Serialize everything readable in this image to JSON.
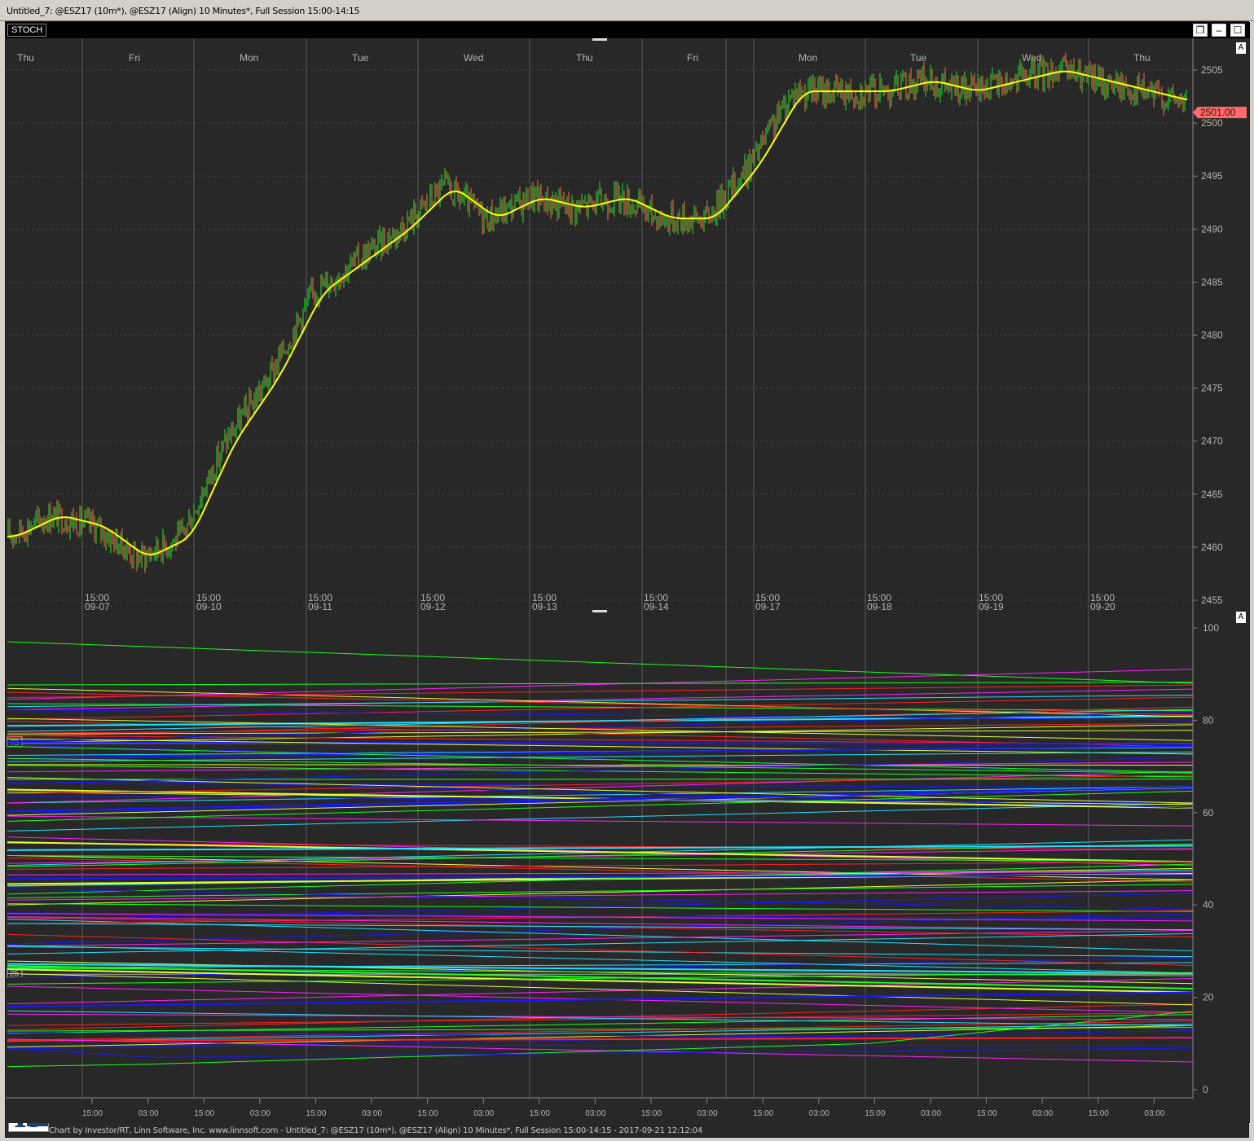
{
  "window": {
    "title": "Untitled_7: @ESZ17 (10m*), @ESZ17 (Align) 10 Minutes*, Full Session 15:00-14:15"
  },
  "toolbar": {
    "indicator_tab": "STOCH",
    "restore_icon": "restore-icon",
    "minimize_icon": "minimize-icon",
    "maximize_icon": "maximize-icon",
    "scale_badge": "A"
  },
  "price_chart": {
    "day_labels": [
      "Thu",
      "Fri",
      "Mon",
      "Tue",
      "Wed",
      "Thu",
      "Fri",
      "Mon",
      "Tue",
      "Wed",
      "Thu"
    ],
    "price_ticks": [
      "2505",
      "2500",
      "2495",
      "2490",
      "2485",
      "2480",
      "2475",
      "2470",
      "2465",
      "2460",
      "2455"
    ],
    "last_price": "2501.00",
    "time_labels": [
      {
        "time": "15:00",
        "date": "09-07"
      },
      {
        "time": "15:00",
        "date": "09-10"
      },
      {
        "time": "15:00",
        "date": "09-11"
      },
      {
        "time": "15:00",
        "date": "09-12"
      },
      {
        "time": "15:00",
        "date": "09-13"
      },
      {
        "time": "15:00",
        "date": "09-14"
      },
      {
        "time": "15:00",
        "date": "09-17"
      },
      {
        "time": "15:00",
        "date": "09-18"
      },
      {
        "time": "15:00",
        "date": "09-19"
      },
      {
        "time": "15:00",
        "date": "09-20"
      }
    ],
    "colors": {
      "background": "#282828",
      "up_bar": "#22c42a",
      "down_bar": "#d2693c",
      "moving_average": "#ffff00",
      "last_price_marker": "#ff6a6a"
    }
  },
  "stoch_chart": {
    "ticks": [
      "100",
      "80",
      "60",
      "40",
      "20",
      "0"
    ],
    "level_labels": [
      "75",
      "25"
    ],
    "time_axis": [
      "15:00",
      "03:00",
      "15:00",
      "03:00",
      "15:00",
      "03:00",
      "15:00",
      "03:00",
      "15:00",
      "03:00",
      "15:00",
      "03:00",
      "15:00",
      "03:00",
      "15:00",
      "03:00",
      "15:00",
      "03:00",
      "15:00",
      "03:00"
    ],
    "line_colors": [
      "#18ff18",
      "#ff2020",
      "#1818ff",
      "#ff20ff",
      "#20e0ff",
      "#e0ff30"
    ]
  },
  "footer": {
    "text": "Chart by Investor/RT, Linn Software, Inc. www.linnsoft.com - Untitled_7: @ESZ17 (10m*), @ESZ17 (Align) 10 Minutes*, Full Session 15:00-14:15 - 2017-09-21 12:12:04"
  },
  "chart_data": {
    "type": "line",
    "title": "",
    "series": [
      {
        "values": [
          2461,
          2463,
          2462,
          2459,
          2461,
          2470,
          2476,
          2484,
          2487,
          2490,
          2494,
          2491,
          2493,
          2492,
          2493,
          2491,
          2491,
          2496,
          2503,
          2503,
          2503,
          2504,
          2503,
          2504,
          2505,
          2504,
          2503,
          2502
        ]
      }
    ],
    "ylim": [
      2454,
      2508
    ],
    "last_value": 2501.0
  }
}
